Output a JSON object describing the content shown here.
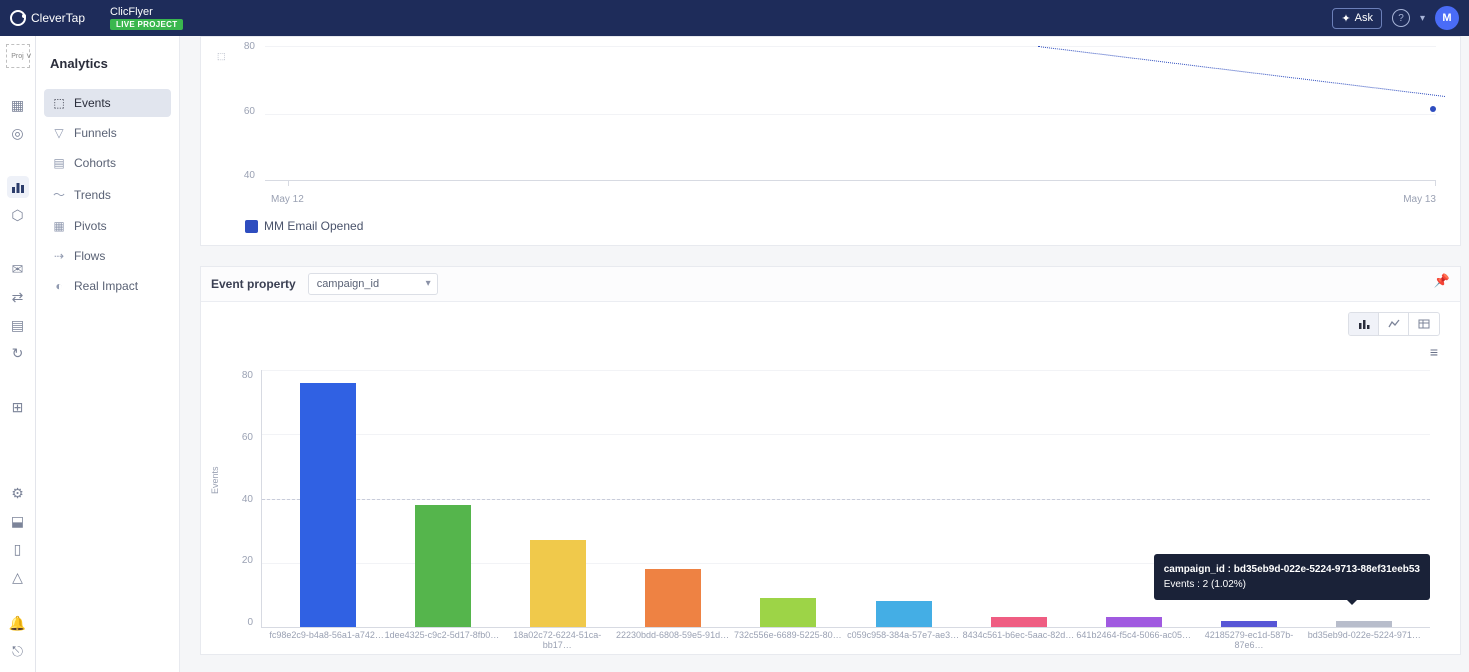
{
  "header": {
    "logo_text": "CleverTap",
    "project_name": "ClicFlyer",
    "live_badge": "LIVE PROJECT",
    "ask_label": "Ask",
    "help_text": "?",
    "avatar_initial": "M"
  },
  "rail": {
    "proj_label": "Proj"
  },
  "sidebar": {
    "title": "Analytics",
    "items": [
      {
        "label": "Events",
        "active": true
      },
      {
        "label": "Funnels",
        "active": false
      },
      {
        "label": "Cohorts",
        "active": false
      },
      {
        "label": "Trends",
        "active": false
      },
      {
        "label": "Pivots",
        "active": false
      },
      {
        "label": "Flows",
        "active": false
      },
      {
        "label": "Real Impact",
        "active": false
      }
    ]
  },
  "line_chart": {
    "legend_label": "MM Email Opened",
    "y_ticks": [
      "80",
      "60",
      "40"
    ],
    "x_ticks": [
      "May 12",
      "May 13"
    ]
  },
  "prop_section": {
    "label": "Event property",
    "select_value": "campaign_id"
  },
  "bar_chart_display": {
    "hamb": "≡",
    "y_ticks": [
      "80",
      "60",
      "40",
      "20",
      "0"
    ],
    "y_label": "Events"
  },
  "tooltip": {
    "line1": "campaign_id : bd35eb9d-022e-5224-9713-88ef31eeb53",
    "line2": "Events : 2 (1.02%)"
  },
  "chart_data": [
    {
      "type": "line",
      "title": "",
      "legend": [
        "MM Email Opened"
      ],
      "xlabel": "",
      "ylabel": "",
      "x_ticks": [
        "May 12",
        "May 13"
      ],
      "y_ticks": [
        40,
        60,
        80
      ],
      "ylim": [
        40,
        80
      ],
      "series": [
        {
          "name": "MM Email Opened",
          "x": [
            "May 12",
            "May 13"
          ],
          "values": [
            null,
            62
          ],
          "style": "dotted",
          "color": "#2e4dbf"
        }
      ]
    },
    {
      "type": "bar",
      "title": "",
      "xlabel": "",
      "ylabel": "Events",
      "ylim": [
        0,
        80
      ],
      "x_property": "campaign_id",
      "categories": [
        "fc98e2c9-b4a8-56a1-a742…",
        "1dee4325-c9c2-5d17-8fb0…",
        "18a02c72-6224-51ca-bb17…",
        "22230bdd-6808-59e5-91d…",
        "732c556e-6689-5225-80…",
        "c059c958-384a-57e7-ae3…",
        "8434c561-b6ec-5aac-82d…",
        "641b2464-f5c4-5066-ac05…",
        "42185279-ec1d-587b-87e6…",
        "bd35eb9d-022e-5224-971…"
      ],
      "values": [
        76,
        38,
        27,
        18,
        9,
        8,
        3,
        3,
        2,
        2
      ],
      "colors": [
        "#3061e3",
        "#55b54c",
        "#f0c94b",
        "#ee8243",
        "#9dd447",
        "#44aee5",
        "#ef5d82",
        "#a05ae0",
        "#5756d6",
        "#b8bdcb"
      ],
      "annotations": [
        {
          "category_index": 9,
          "text": "campaign_id : bd35eb9d-022e-5224-9713-88ef31eeb53",
          "value_text": "Events : 2 (1.02%)"
        }
      ]
    }
  ]
}
